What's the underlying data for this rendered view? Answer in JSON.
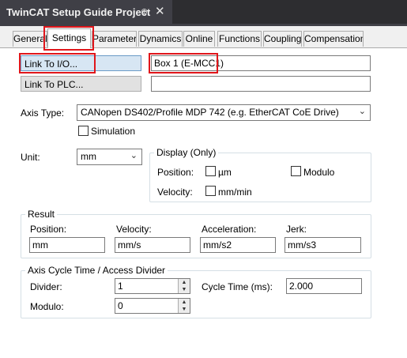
{
  "window": {
    "title": "TwinCAT Setup Guide Project",
    "pin_glyph": "⊕",
    "close_glyph": "✕"
  },
  "tabs": [
    {
      "label": "General"
    },
    {
      "label": "Settings"
    },
    {
      "label": "Parameter"
    },
    {
      "label": "Dynamics"
    },
    {
      "label": "Online"
    },
    {
      "label": "Functions"
    },
    {
      "label": "Coupling"
    },
    {
      "label": "Compensation"
    }
  ],
  "link": {
    "io_button": "Link To I/O...",
    "io_value": "Box 1 (E-MCC1)",
    "plc_button": "Link To PLC...",
    "plc_value": ""
  },
  "axis": {
    "type_label": "Axis Type:",
    "type_value": "CANopen DS402/Profile MDP 742 (e.g. EtherCAT CoE Drive)",
    "simulation_label": "Simulation"
  },
  "unit": {
    "label": "Unit:",
    "value": "mm"
  },
  "display": {
    "title": "Display (Only)",
    "position_label": "Position:",
    "position_option": "µm",
    "modulo_option": "Modulo",
    "velocity_label": "Velocity:",
    "velocity_option": "mm/min"
  },
  "result": {
    "title": "Result",
    "position_label": "Position:",
    "position_value": "mm",
    "velocity_label": "Velocity:",
    "velocity_value": "mm/s",
    "acceleration_label": "Acceleration:",
    "acceleration_value": "mm/s2",
    "jerk_label": "Jerk:",
    "jerk_value": "mm/s3"
  },
  "cycle": {
    "title": "Axis Cycle Time / Access Divider",
    "divider_label": "Divider:",
    "divider_value": "1",
    "cycle_time_label": "Cycle Time (ms):",
    "cycle_time_value": "2.000",
    "modulo_label": "Modulo:",
    "modulo_value": "0"
  },
  "colors": {
    "highlight": "#e0161b",
    "title_bar": "#2d2d30"
  }
}
